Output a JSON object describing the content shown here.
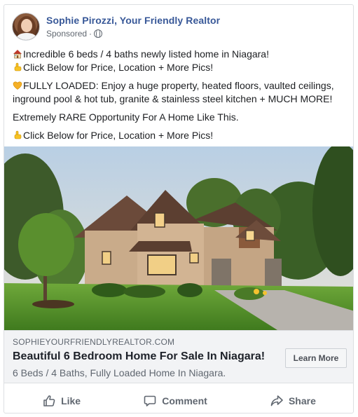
{
  "post": {
    "page_name": "Sophie Pirozzi, Your Friendly Realtor",
    "sponsored_label": "Sponsored",
    "separator": "·",
    "privacy_icon": "globe-icon",
    "avatar_icon": "profile-photo"
  },
  "body": {
    "line1": "Incredible 6 beds / 4 baths newly listed home in Niagara!",
    "line1_icon": "house-emoji",
    "line2": "Click Below for Price, Location + More Pics!",
    "line2_icon": "pointing-down-emoji",
    "line3": "FULLY LOADED: Enjoy a huge property, heated floors, vaulted ceilings, inground pool & hot tub, granite & stainless steel kitchen + MUCH MORE!",
    "line3_icon": "yellow-heart-emoji",
    "line4": "Extremely RARE Opportunity For A Home Like This.",
    "line5": "Click Below for Price, Location + More Pics!",
    "line5_icon": "pointing-down-emoji"
  },
  "link": {
    "domain": "SOPHIEYOURFRIENDLYREALTOR.COM",
    "headline": "Beautiful 6 Bedroom Home For Sale In Niagara!",
    "description": "6 Beds / 4 Baths, Fully Loaded Home In Niagara.",
    "cta_label": "Learn More"
  },
  "actions": {
    "like": "Like",
    "comment": "Comment",
    "share": "Share"
  },
  "colors": {
    "page_name": "#385898",
    "secondary_text": "#606770",
    "link_box_bg": "#f2f3f5"
  }
}
